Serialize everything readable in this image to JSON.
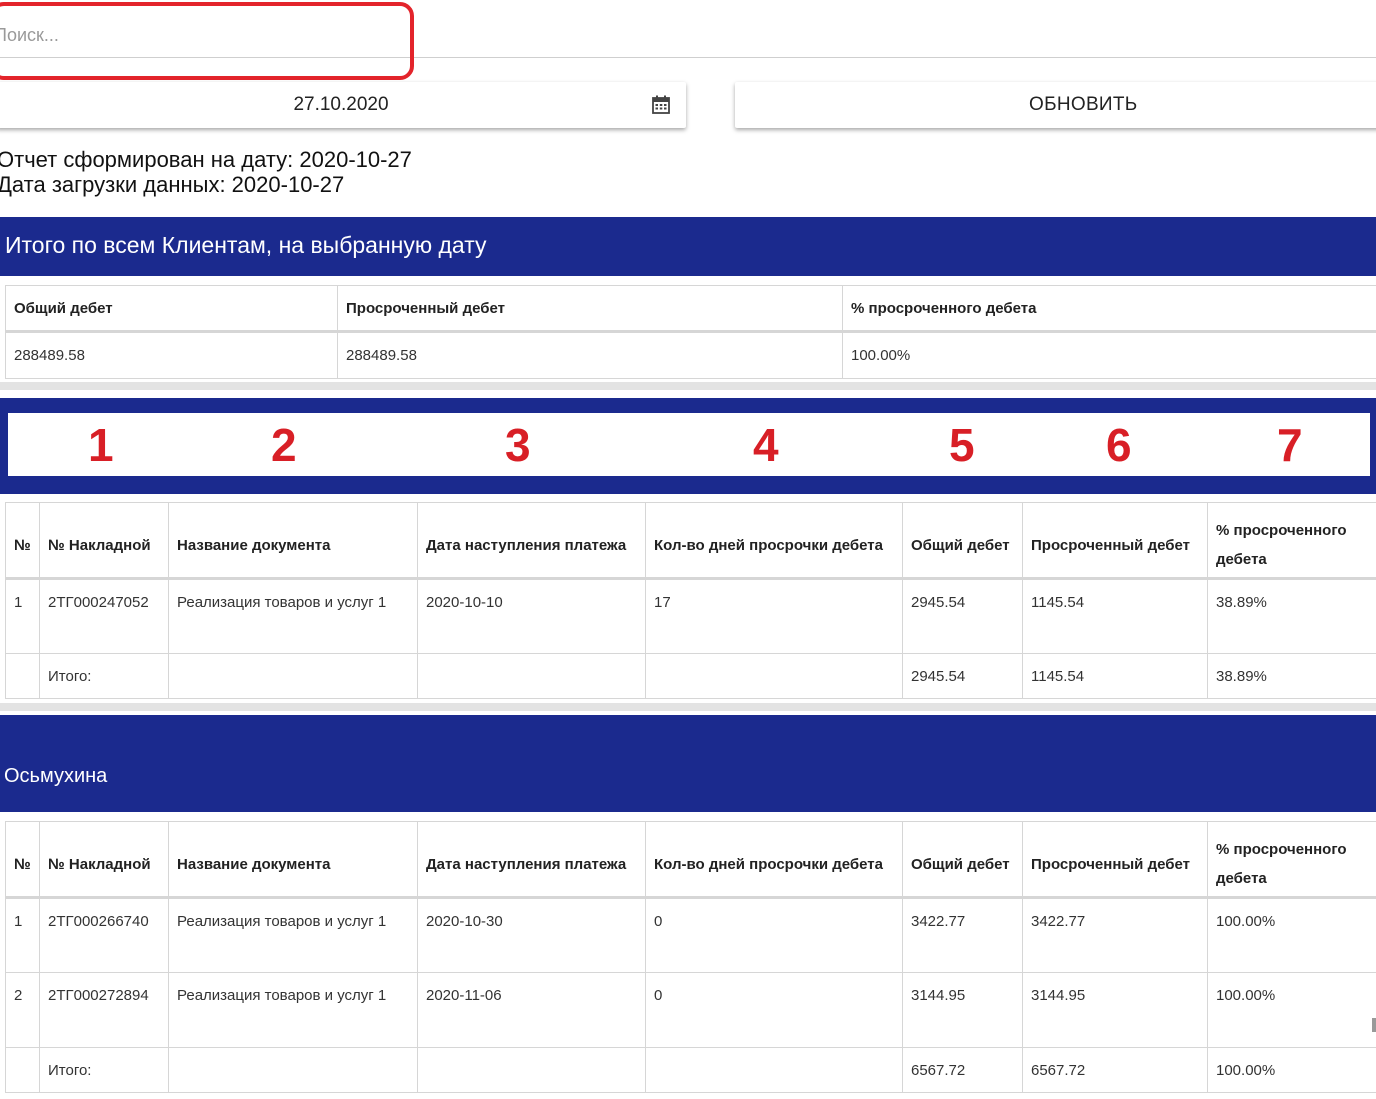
{
  "search": {
    "placeholder": "Поиск..."
  },
  "date_picker": {
    "value": "27.10.2020"
  },
  "refresh_label": "ОБНОВИТЬ",
  "report_date": "Отчет сформирован на дату: 2020-10-27",
  "load_date": "Дата загрузки данных: 2020-10-27",
  "totals_section": {
    "title": "Итого по всем Клиентам, на выбранную дату",
    "headers": [
      "Общий дебет",
      "Просроченный дебет",
      "% просроченного дебета"
    ],
    "values": [
      "288489.58",
      "288489.58",
      "100.00%"
    ]
  },
  "annotation_numbers": [
    "1",
    "2",
    "3",
    "4",
    "5",
    "6",
    "7"
  ],
  "client_2_name": "Осьмухина",
  "detail_headers": {
    "num": "№",
    "invoice": "№ Накладной",
    "doc_name": "Название документа",
    "due_date": "Дата наступления платежа",
    "overdue_days": "Кол-во дней просрочки дебета",
    "total_debit": "Общий дебет",
    "overdue_debit": "Просроченный дебет",
    "overdue_pct": "% просроченного дебета"
  },
  "client_1": {
    "rows": [
      {
        "num": "1",
        "invoice": "2ТГ000247052",
        "doc_name": "Реализация товаров и услуг 1",
        "due_date": "2020-10-10",
        "overdue_days": "17",
        "total_debit": "2945.54",
        "overdue_debit": "1145.54",
        "overdue_pct": "38.89%"
      }
    ],
    "sum": {
      "label": "Итого:",
      "total_debit": "2945.54",
      "overdue_debit": "1145.54",
      "overdue_pct": "38.89%"
    }
  },
  "client_2": {
    "rows": [
      {
        "num": "1",
        "invoice": "2ТГ000266740",
        "doc_name": "Реализация товаров и услуг 1",
        "due_date": "2020-10-30",
        "overdue_days": "0",
        "total_debit": "3422.77",
        "overdue_debit": "3422.77",
        "overdue_pct": "100.00%"
      },
      {
        "num": "2",
        "invoice": "2ТГ000272894",
        "doc_name": "Реализация товаров и услуг 1",
        "due_date": "2020-11-06",
        "overdue_days": "0",
        "total_debit": "3144.95",
        "overdue_debit": "3144.95",
        "overdue_pct": "100.00%"
      }
    ],
    "sum": {
      "label": "Итого:",
      "total_debit": "6567.72",
      "overdue_debit": "6567.72",
      "overdue_pct": "100.00%"
    }
  },
  "colors": {
    "header_blue": "#1b2a8e",
    "annotation_red": "#e3242b"
  },
  "icons": {
    "date_picker": "calendar-icon"
  }
}
